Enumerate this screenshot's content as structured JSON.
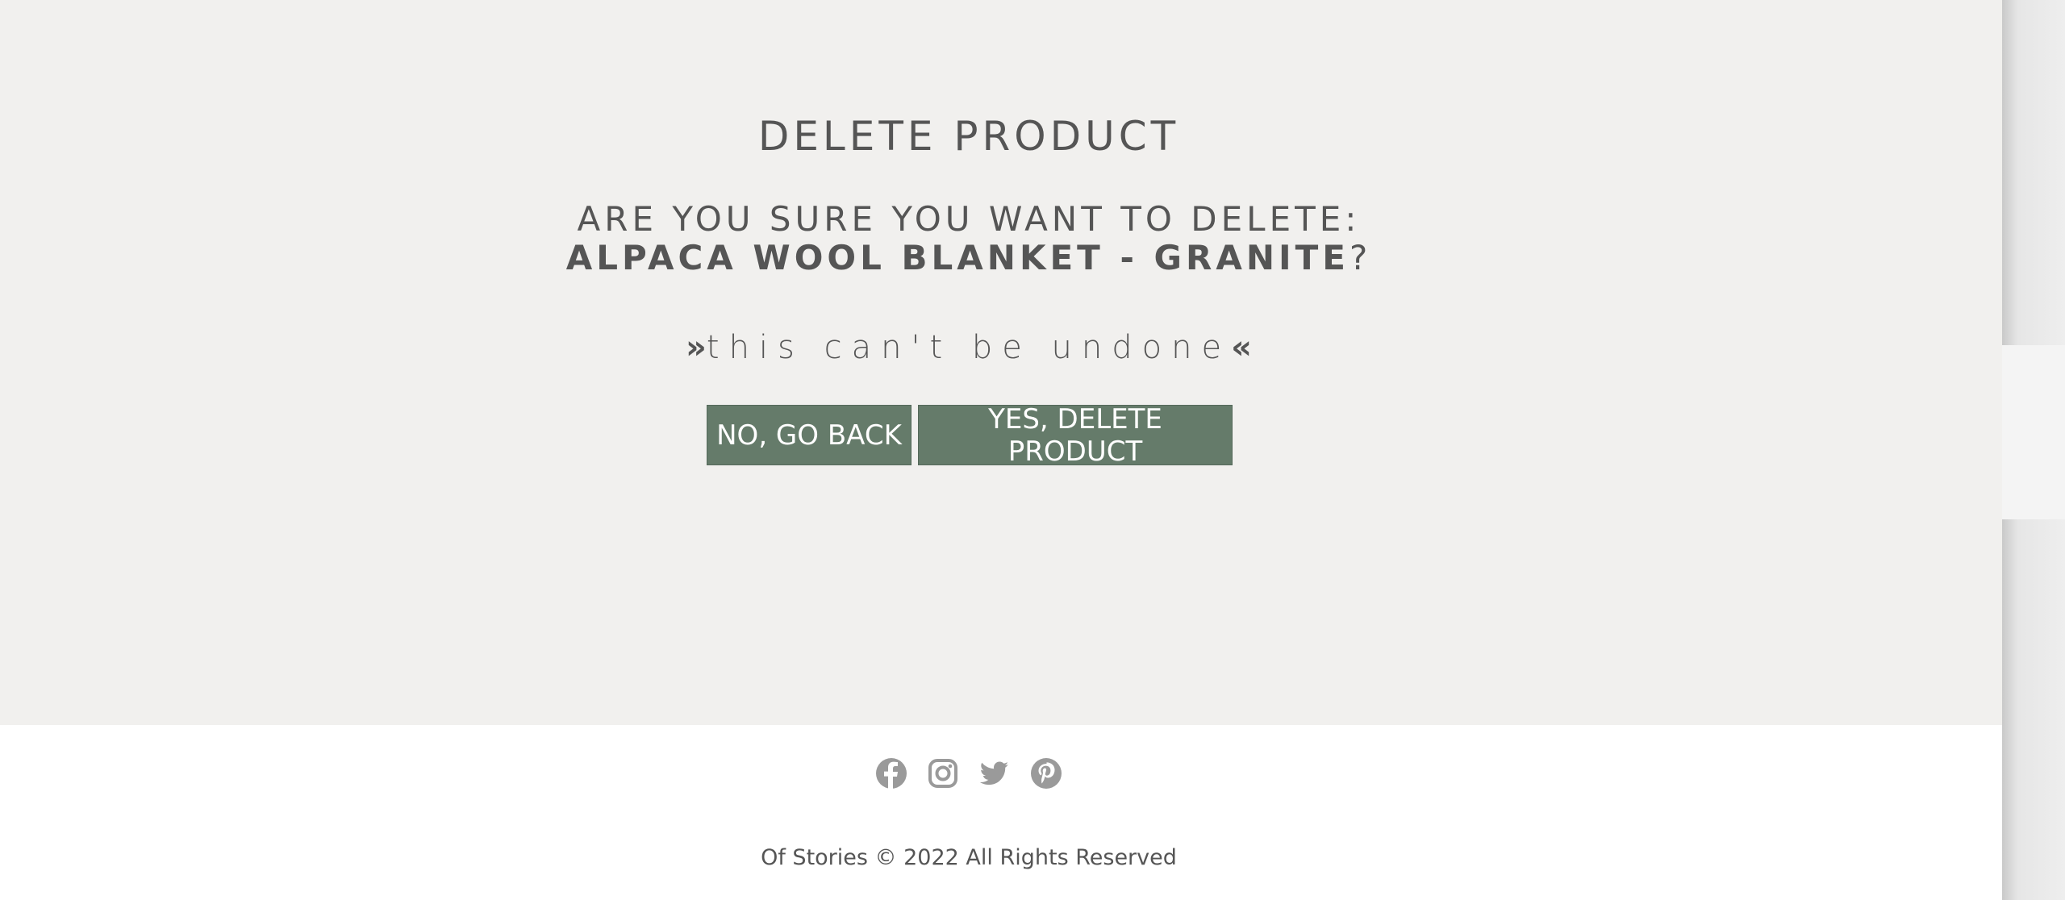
{
  "dialog": {
    "title": "DELETE PRODUCT",
    "question": "ARE YOU SURE YOU WANT TO DELETE:",
    "product_name": "ALPACA WOOL BLANKET - GRANITE",
    "question_mark": "?",
    "warning_left": "»",
    "warning_text": "this can't be undone",
    "warning_right": "«",
    "no_button": "NO, GO BACK",
    "yes_button": "YES, DELETE PRODUCT"
  },
  "footer": {
    "social_icons": [
      "facebook-icon",
      "instagram-icon",
      "twitter-icon",
      "pinterest-icon"
    ],
    "copyright": "Of Stories © 2022 All Rights Reserved"
  },
  "colors": {
    "background": "#f1f0ee",
    "button": "#657b6a",
    "text": "#555555",
    "icon": "#9a9a9a"
  }
}
